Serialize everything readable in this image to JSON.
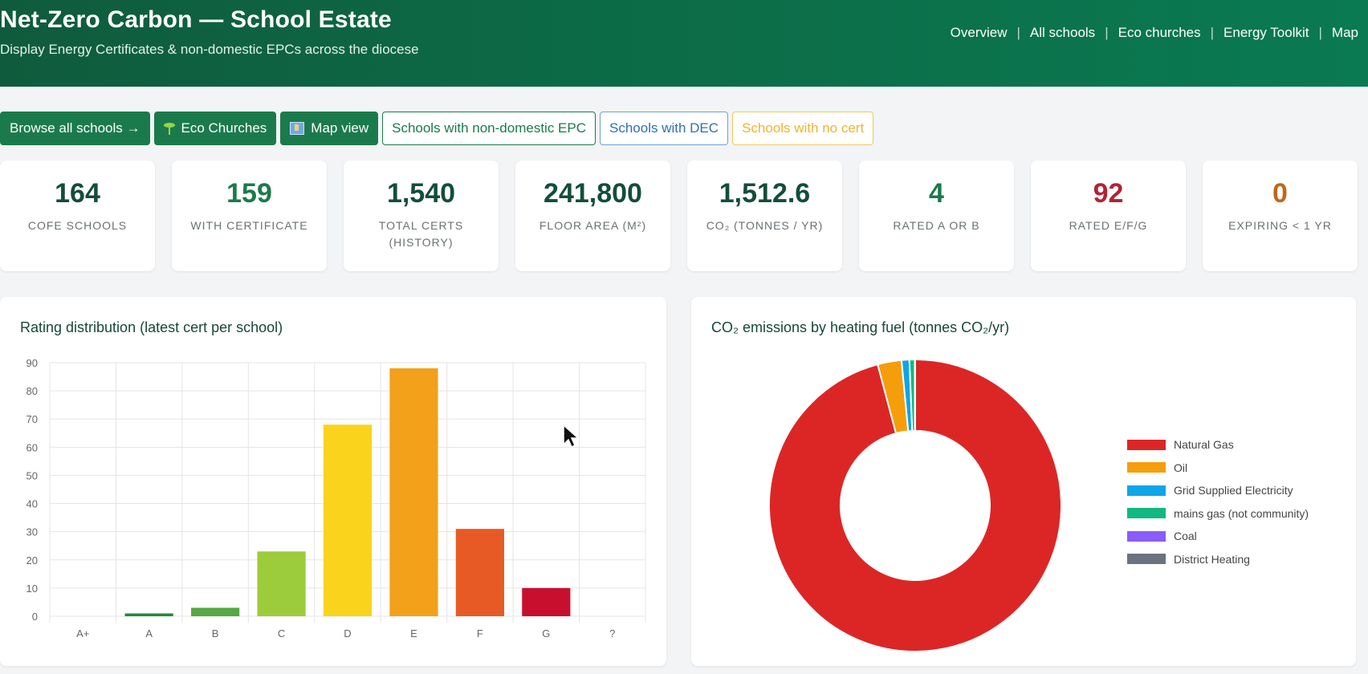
{
  "header": {
    "title": "Net-Zero Carbon — School Estate",
    "subtitle": "Display Energy Certificates & non-domestic EPCs across the diocese",
    "nav": [
      "Overview",
      "All schools",
      "Eco churches",
      "Energy Toolkit",
      "Map"
    ]
  },
  "toolbar": {
    "browse": "Browse all schools →",
    "eco": "Eco Churches",
    "map": "Map view",
    "nondomestic": "Schools with non-domestic EPC",
    "dec": "Schools with DEC",
    "nocert": "Schools with no cert"
  },
  "stats": [
    {
      "value": "164",
      "label": "COFE SCHOOLS"
    },
    {
      "value": "159",
      "label": "WITH CERTIFICATE"
    },
    {
      "value": "1,540",
      "label": "TOTAL CERTS (HISTORY)"
    },
    {
      "value": "241,800",
      "label": "FLOOR AREA (M²)"
    },
    {
      "value": "1,512.6",
      "label": "CO₂ (TONNES / YR)"
    },
    {
      "value": "4",
      "label": "RATED A OR B"
    },
    {
      "value": "92",
      "label": "RATED E/F/G"
    },
    {
      "value": "0",
      "label": "EXPIRING < 1 YR"
    }
  ],
  "panels": {
    "rating_title": "Rating distribution (latest cert per school)",
    "co2_title": "CO₂ emissions by heating fuel (tonnes CO₂/yr)"
  },
  "chart_data": [
    {
      "type": "bar",
      "title": "Rating distribution (latest cert per school)",
      "categories": [
        "A+",
        "A",
        "B",
        "C",
        "D",
        "E",
        "F",
        "G",
        "?"
      ],
      "values": [
        0,
        1,
        3,
        23,
        68,
        88,
        31,
        10,
        0
      ],
      "colors": [
        "#1a7a3c",
        "#1f8a3f",
        "#56a843",
        "#9ccc3c",
        "#f9d31c",
        "#f3a01a",
        "#e85a25",
        "#c8102e",
        "#999999"
      ],
      "ylim": [
        0,
        90
      ],
      "yticks": [
        0,
        10,
        20,
        30,
        40,
        50,
        60,
        70,
        80,
        90
      ],
      "grid": true
    },
    {
      "type": "pie",
      "title": "CO₂ emissions by heating fuel (tonnes CO₂/yr)",
      "labels": [
        "Natural Gas",
        "Oil",
        "Grid Supplied Electricity",
        "mains gas (not community)",
        "Coal",
        "District Heating"
      ],
      "values": [
        1450,
        40,
        13,
        9,
        0.4,
        0.2
      ],
      "colors": [
        "#dc2626",
        "#f59e0b",
        "#0ea5e9",
        "#10b981",
        "#8b5cf6",
        "#6b7280"
      ],
      "legend": "right"
    }
  ]
}
